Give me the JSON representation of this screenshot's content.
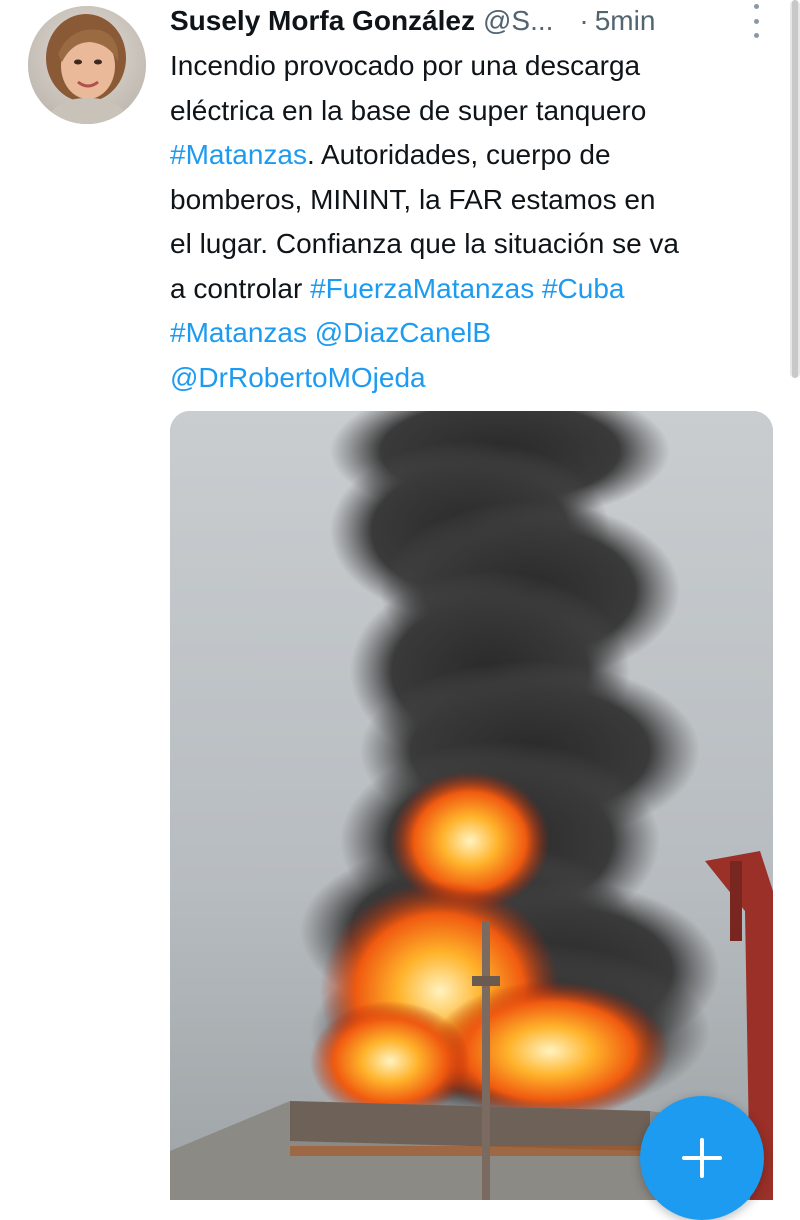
{
  "tweet": {
    "author": {
      "name": "Susely Morfa González",
      "handle": "@S...",
      "separator": "·",
      "time": "5min"
    },
    "lines": [
      [
        {
          "text": "Incendio provocado por una descarga",
          "link": false
        }
      ],
      [
        {
          "text": "eléctrica en la base de super tanquero",
          "link": false
        }
      ],
      [
        {
          "text": "#Matanzas",
          "link": true
        },
        {
          "text": ". Autoridades, cuerpo de",
          "link": false
        }
      ],
      [
        {
          "text": "bomberos, MININT, la FAR  estamos en",
          "link": false
        }
      ],
      [
        {
          "text": "el lugar. Confianza que la situación se va",
          "link": false
        }
      ],
      [
        {
          "text": "a controlar ",
          "link": false
        },
        {
          "text": "#FuerzaMatanzas",
          "link": true
        },
        {
          "text": " ",
          "link": false
        },
        {
          "text": "#Cuba",
          "link": true
        }
      ],
      [
        {
          "text": "#Matanzas",
          "link": true
        },
        {
          "text": " ",
          "link": false
        },
        {
          "text": "@DiazCanelB",
          "link": true
        }
      ],
      [
        {
          "text": "@DrRobertoMOjeda",
          "link": true
        }
      ]
    ],
    "media": {
      "kind": "photo",
      "subject": "fire-and-smoke"
    }
  },
  "colors": {
    "link": "#1d9bf0",
    "text": "#0f1419",
    "secondary": "#536471",
    "fab": "#1d9bf0"
  },
  "icons": {
    "more": "more-vertical-icon",
    "compose": "plus-icon"
  }
}
